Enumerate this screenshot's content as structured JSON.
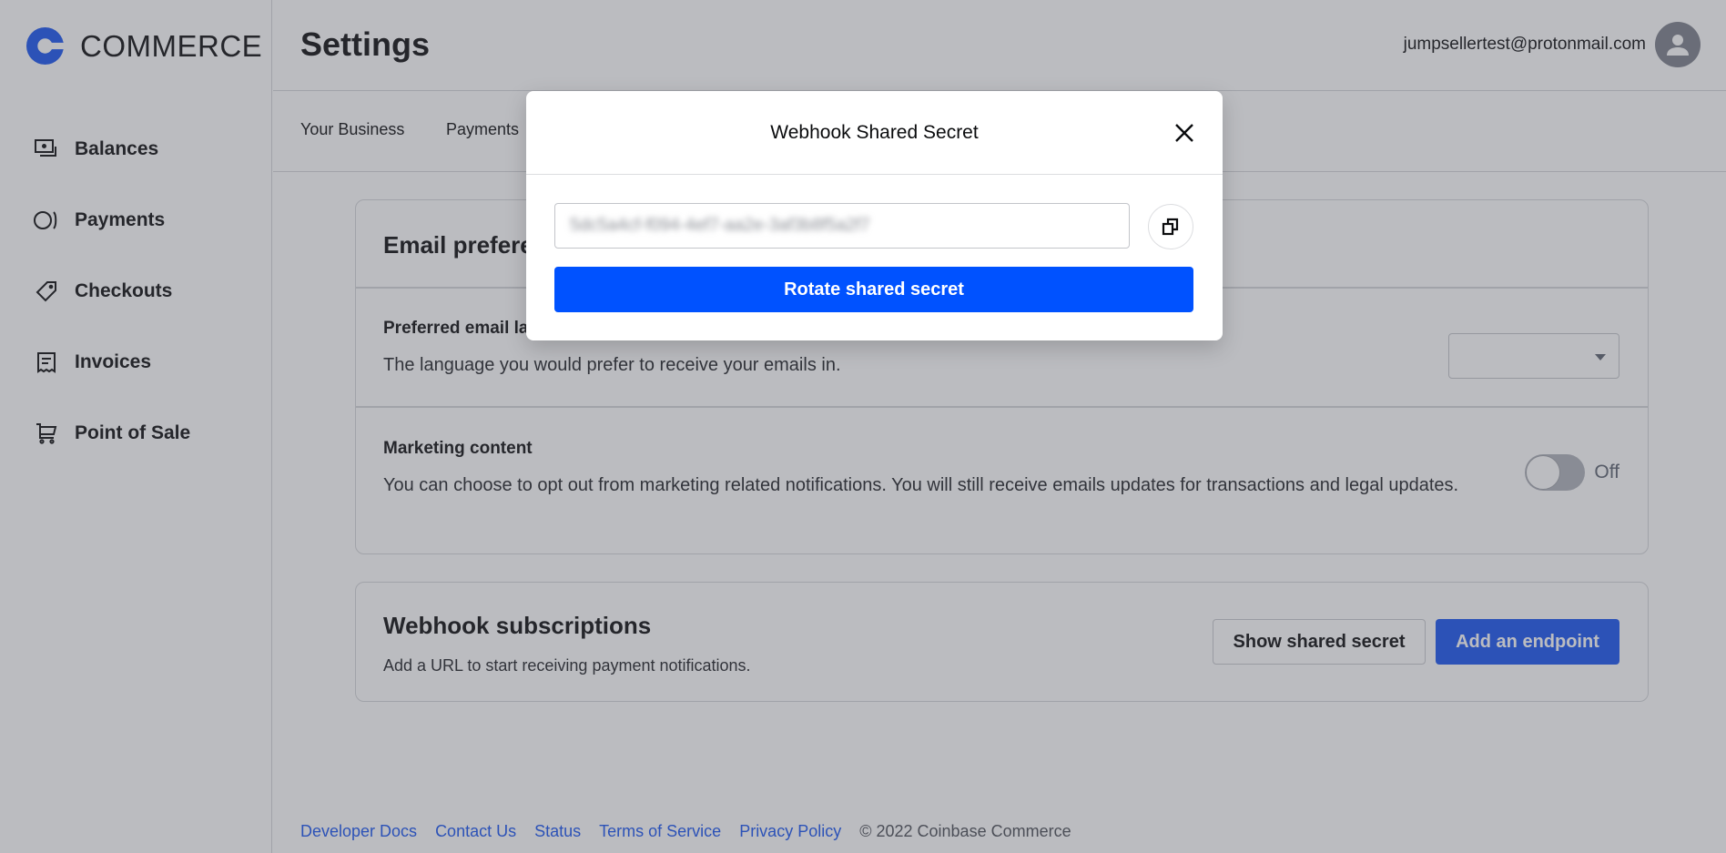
{
  "brand": {
    "name": "COMMERCE",
    "logo_icon": "coinbase-c-logo-icon",
    "color": "#1652f0"
  },
  "sidebar": {
    "items": [
      {
        "label": "Balances",
        "icon": "balances-icon"
      },
      {
        "label": "Payments",
        "icon": "payments-icon"
      },
      {
        "label": "Checkouts",
        "icon": "tag-icon"
      },
      {
        "label": "Invoices",
        "icon": "receipt-icon"
      },
      {
        "label": "Point of Sale",
        "icon": "cart-icon"
      }
    ]
  },
  "header": {
    "title": "Settings",
    "user_email": "jumpsellertest@protonmail.com",
    "avatar_icon": "user-avatar-icon"
  },
  "tabs": [
    {
      "label": "Your Business"
    },
    {
      "label": "Payments"
    }
  ],
  "email_preferences": {
    "title": "Email preferences",
    "preferred_email": {
      "title": "Preferred email language",
      "description": "The language you would prefer to receive your emails in.",
      "selected_value": ""
    },
    "marketing": {
      "title": "Marketing content",
      "description": "You can choose to opt out from marketing related notifications. You will still receive emails updates for transactions and legal updates.",
      "toggle_state": "Off"
    }
  },
  "webhooks": {
    "title": "Webhook subscriptions",
    "description": "Add a URL to start receiving payment notifications.",
    "show_secret_label": "Show shared secret",
    "add_endpoint_label": "Add an endpoint"
  },
  "footer": {
    "links": [
      "Developer Docs",
      "Contact Us",
      "Status",
      "Terms of Service",
      "Privacy Policy"
    ],
    "copyright": "© 2022 Coinbase Commerce"
  },
  "modal": {
    "title": "Webhook Shared Secret",
    "secret_value": "5dc5a4cf-f094-4ef7-aa2e-3af3b8f5a2f7",
    "secret_obscured": true,
    "copy_icon": "copy-icon",
    "close_icon": "close-icon",
    "rotate_label": "Rotate shared secret",
    "rotate_color": "#0052ff"
  }
}
